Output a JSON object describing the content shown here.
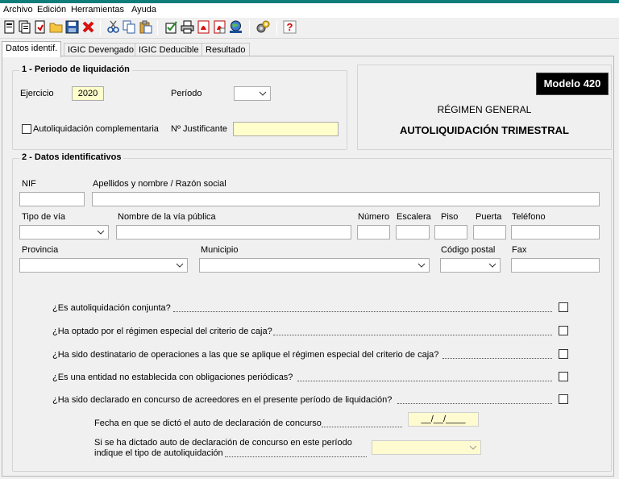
{
  "menu": [
    "Archivo",
    "Edición",
    "Herramientas",
    "Ayuda"
  ],
  "toolbar_icons": [
    "new-icon",
    "open-icon",
    "import-icon",
    "folder-icon",
    "save-icon",
    "delete-icon",
    "cut-icon",
    "copy-icon",
    "paste-icon",
    "validate-icon",
    "print-icon",
    "pdf-icon",
    "pdf-preview-icon",
    "web-icon",
    "settings-icon",
    "help-icon"
  ],
  "tabs": [
    "Datos identif.",
    "IGIC Devengado",
    "IGIC Deducible",
    "Resultado"
  ],
  "section1": {
    "legend": "1 - Periodo de liquidación",
    "ejercicio_label": "Ejercicio",
    "ejercicio_value": "2020",
    "periodo_label": "Período",
    "periodo_value": "",
    "complementaria_label": "Autoliquidación complementaria",
    "justificante_label": "Nº Justificante",
    "justificante_value": ""
  },
  "modelo": {
    "badge": "Modelo 420",
    "regimen": "RÉGIMEN GENERAL",
    "title": "AUTOLIQUIDACIÓN TRIMESTRAL"
  },
  "section2": {
    "legend": "2 - Datos identificativos",
    "labels": {
      "nif": "NIF",
      "nombre": "Apellidos y nombre / Razón social",
      "tipo_via": "Tipo de vía",
      "nombre_via": "Nombre de la vía pública",
      "numero": "Número",
      "escalera": "Escalera",
      "piso": "Piso",
      "puerta": "Puerta",
      "telefono": "Teléfono",
      "provincia": "Provincia",
      "municipio": "Municipio",
      "codigo_postal": "Código postal",
      "fax": "Fax"
    }
  },
  "questions": [
    "¿Es autoliquidación conjunta?",
    "¿Ha optado por el régimen especial del criterio de caja?",
    "¿Ha sido destinatario de operaciones a las que se aplique el régimen especial del criterio de caja?",
    "¿Es una entidad no establecida con obligaciones periódicas?",
    "¿Ha sido declarado en concurso de acreedores en el presente período de liquidación?"
  ],
  "concurso": {
    "fecha_label": "Fecha en que se dictó el auto de declaración de concurso",
    "fecha_value": "__/__/____",
    "tipo_label_1": "Si se ha dictado auto de declaración de concurso en este período",
    "tipo_label_2": "indique el tipo de autoliquidación"
  }
}
